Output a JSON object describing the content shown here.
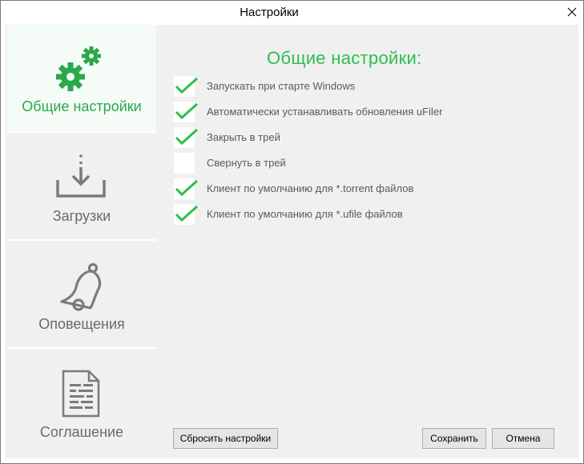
{
  "window": {
    "title": "Настройки"
  },
  "sidebar": {
    "items": [
      {
        "label": "Общие настройки",
        "icon": "gears-icon",
        "active": true
      },
      {
        "label": "Загрузки",
        "icon": "download-icon",
        "active": false
      },
      {
        "label": "Оповещения",
        "icon": "bell-icon",
        "active": false
      },
      {
        "label": "Соглашение",
        "icon": "document-icon",
        "active": false
      }
    ]
  },
  "main": {
    "heading": "Общие настройки:",
    "options": [
      {
        "label": "Запускать при старте Windows",
        "checked": true
      },
      {
        "label": "Автоматически устанавливать обновления uFiler",
        "checked": true
      },
      {
        "label": "Закрыть в трей",
        "checked": true
      },
      {
        "label": "Свернуть в трей",
        "checked": false
      },
      {
        "label": "Клиент по умолчанию для *.torrent файлов",
        "checked": true
      },
      {
        "label": "Клиент по умолчанию для *.ufile файлов",
        "checked": true
      }
    ]
  },
  "buttons": {
    "reset": "Сбросить настройки",
    "save": "Сохранить",
    "cancel": "Отмена"
  },
  "colors": {
    "accent": "#2fbd4c",
    "gear": "#2aa84a",
    "icon_gray": "#7b7b7b",
    "panel": "#f0f0f0"
  }
}
